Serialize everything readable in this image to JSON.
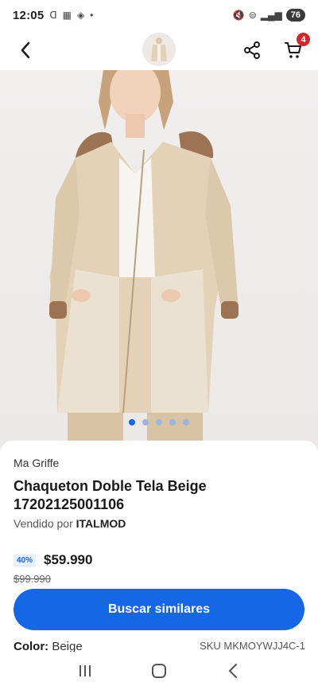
{
  "status": {
    "time": "12:05",
    "battery": "76"
  },
  "product": {
    "brand": "Ma Griffe",
    "title": "Chaqueton Doble Tela Beige 17202125001106",
    "seller_prefix": "Vendido por",
    "seller_name": "ITALMOD",
    "discount": "40%",
    "price": "$59.990",
    "old_price": "$99.990",
    "color_label": "Color:",
    "color_value": "Beige",
    "sku": "SKU MKMOYWJJ4C-1"
  },
  "gallery": {
    "image_count": 5,
    "active_index": 0
  },
  "cart": {
    "count": "4"
  },
  "actions": {
    "search_similar": "Buscar similares"
  },
  "icons": {
    "back": "chevron-left-icon",
    "share": "share-icon",
    "cart": "cart-icon",
    "recents": "recents-icon",
    "home": "home-icon",
    "back_system": "back-icon"
  },
  "colors": {
    "primary": "#1667e6",
    "badge": "#d0262d",
    "discount_bg": "#e6f0ff"
  }
}
